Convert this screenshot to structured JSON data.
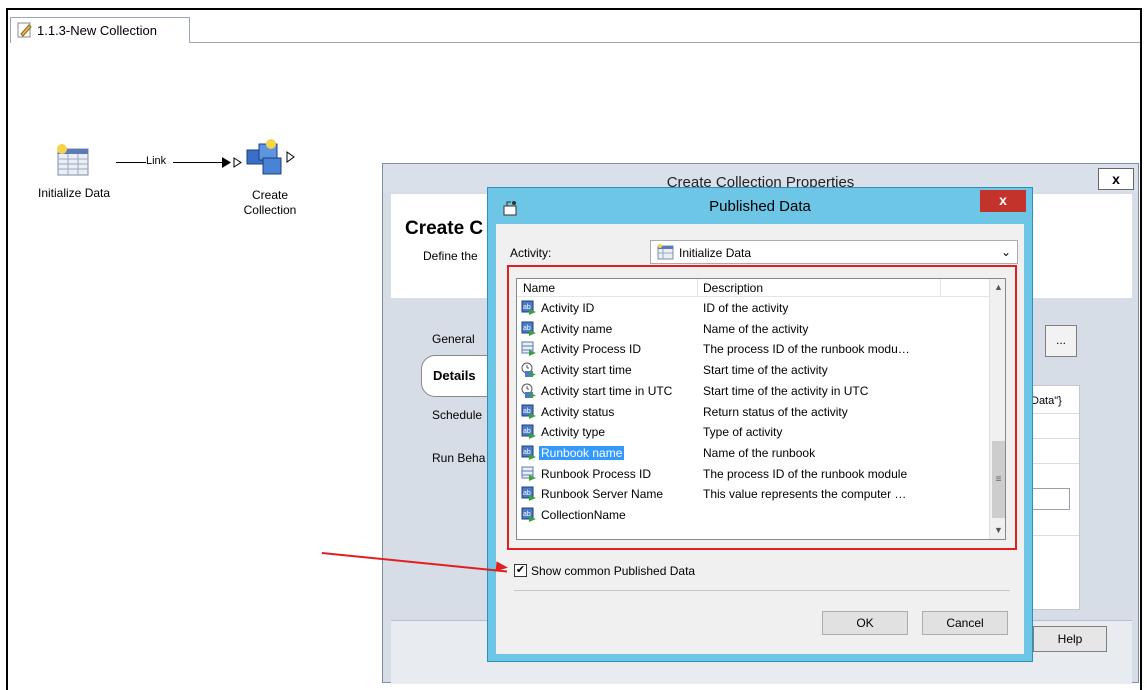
{
  "tab": {
    "label": "1.1.3-New Collection"
  },
  "canvas": {
    "activity1": {
      "label": "Initialize Data"
    },
    "link": {
      "label": "Link"
    },
    "activity2": {
      "label_line1": "Create",
      "label_line2": "Collection"
    }
  },
  "properties_dialog": {
    "title": "Create Collection Properties",
    "close_label": "x",
    "header_title": "Create C",
    "header_subtitle": "Define the",
    "nav": {
      "general": "General",
      "details": "Details",
      "schedule": "Schedule",
      "run_behavior": "Run Beha"
    },
    "ellipsis_label": "...",
    "field_fragment": "Data\"}",
    "help_label": "Help"
  },
  "published_data_dialog": {
    "title": "Published Data",
    "close_label": "x",
    "activity_label": "Activity:",
    "activity_value": "Initialize Data",
    "columns": {
      "name": "Name",
      "description": "Description"
    },
    "rows": [
      {
        "name": "Activity ID",
        "description": "ID of the activity",
        "icon": "text-data-icon"
      },
      {
        "name": "Activity name",
        "description": "Name of the activity",
        "icon": "text-data-icon"
      },
      {
        "name": "Activity Process ID",
        "description": "The process ID of the runbook modu…",
        "icon": "number-data-icon"
      },
      {
        "name": "Activity start time",
        "description": "Start time of the activity",
        "icon": "date-data-icon"
      },
      {
        "name": "Activity start time in UTC",
        "description": "Start time of the activity in UTC",
        "icon": "date-data-icon"
      },
      {
        "name": "Activity status",
        "description": "Return status of the activity",
        "icon": "text-data-icon"
      },
      {
        "name": "Activity type",
        "description": "Type of activity",
        "icon": "text-data-icon"
      },
      {
        "name": "Runbook name",
        "description": "Name of the runbook",
        "icon": "text-data-icon",
        "selected": true
      },
      {
        "name": "Runbook Process ID",
        "description": "The process ID of the runbook module",
        "icon": "number-data-icon"
      },
      {
        "name": "Runbook Server Name",
        "description": "This value represents the computer …",
        "icon": "text-data-icon"
      },
      {
        "name": "CollectionName",
        "description": "",
        "icon": "text-data-icon"
      }
    ],
    "checkbox_label": "Show common Published Data",
    "checkbox_checked": true,
    "ok_label": "OK",
    "cancel_label": "Cancel"
  },
  "colors": {
    "dialog_frame": "#6dc6e5",
    "close_button": "#c4332b",
    "selection": "#3399ff",
    "annotation": "#e02020"
  }
}
